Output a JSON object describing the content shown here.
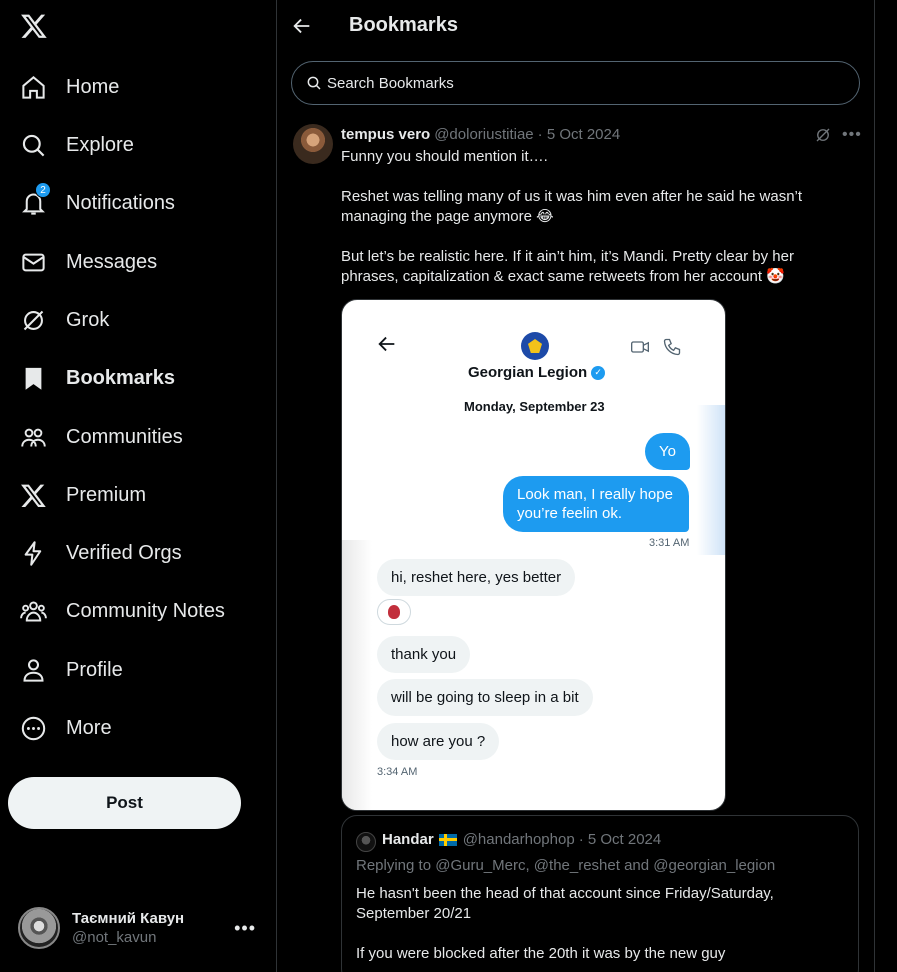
{
  "sidebar": {
    "items": [
      {
        "label": "Home",
        "icon": "home-icon"
      },
      {
        "label": "Explore",
        "icon": "search-icon"
      },
      {
        "label": "Notifications",
        "icon": "bell-icon",
        "badge": "2"
      },
      {
        "label": "Messages",
        "icon": "envelope-icon"
      },
      {
        "label": "Grok",
        "icon": "grok-icon"
      },
      {
        "label": "Bookmarks",
        "icon": "bookmark-icon",
        "active": true
      },
      {
        "label": "Communities",
        "icon": "communities-icon"
      },
      {
        "label": "Premium",
        "icon": "x-logo-icon"
      },
      {
        "label": "Verified Orgs",
        "icon": "lightning-icon"
      },
      {
        "label": "Community Notes",
        "icon": "community-notes-icon"
      },
      {
        "label": "Profile",
        "icon": "person-icon"
      },
      {
        "label": "More",
        "icon": "more-circle-icon"
      }
    ],
    "post_label": "Post",
    "account": {
      "name": "Таємний Кавун",
      "handle": "@not_kavun"
    }
  },
  "header": {
    "title": "Bookmarks"
  },
  "search": {
    "placeholder": "Search Bookmarks"
  },
  "tweet": {
    "author_name": "tempus vero",
    "author_handle": "@doloriustitiae",
    "date": "· 5 Oct 2024",
    "text": "Funny you should mention it….\n\nReshet was telling many of us it was him even after he said he wasn’t managing the page anymore 😂\n\nBut let’s be realistic here. If it ain’t him, it’s Mandi. Pretty clear by her phrases, capitalization & exact same retweets from her account 🤡",
    "media": {
      "contact_name": "Georgian Legion",
      "date_label": "Monday, September 23",
      "sent": [
        "Yo",
        "Look man, I really hope you’re feelin ok."
      ],
      "sent_time": "3:31 AM",
      "received": [
        "hi, reshet here, yes better",
        "thank you",
        "will be going to sleep in a bit",
        "how are you ?"
      ],
      "received_time": "3:34 AM"
    }
  },
  "quote": {
    "author_name": "Handar",
    "author_handle": "@handarhophop",
    "date": "· 5 Oct 2024",
    "replying_to": "Replying to @Guru_Merc, @the_reshet and @georgian_legion",
    "text": "He hasn't been the head of that account since Friday/Saturday, September 20/21\n\nIf you were blocked after the 20th it was by the new guy"
  },
  "colors": {
    "accent": "#1d9bf0",
    "text": "#e7e9ea",
    "muted": "#71767b",
    "border": "#2f3336"
  }
}
